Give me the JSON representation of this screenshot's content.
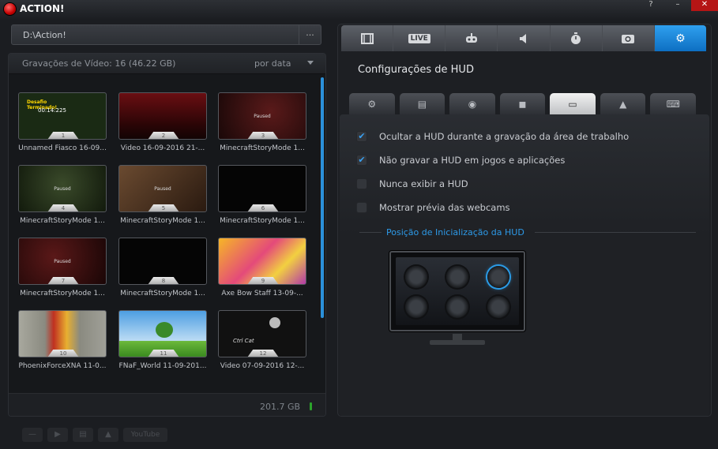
{
  "app": {
    "title": "ACTION!",
    "minimize_glyph": "–",
    "close_glyph": "✕",
    "help_glyph": "?"
  },
  "path": {
    "value": "D:\\Action!",
    "more": "..."
  },
  "library": {
    "recordings_label": "Gravações de Vídeo: 16 (46.22 GB)",
    "sort_label": "por data",
    "free_space": "201.7 GB",
    "videos": [
      {
        "number": "1",
        "name": "Unnamed Fiasco 16-09...",
        "thumb": "#1a2a14",
        "overlay_title": "Desafio Terminado!",
        "overlay_time": "00:14:225"
      },
      {
        "number": "2",
        "name": "Video 16-09-2016 21-...",
        "thumb": "#4a0a0c"
      },
      {
        "number": "3",
        "name": "MinecraftStoryMode 1...",
        "thumb": "#3a1214",
        "paused": "Paused"
      },
      {
        "number": "4",
        "name": "MinecraftStoryMode 1...",
        "thumb": "#1f2a18",
        "paused": "Paused"
      },
      {
        "number": "5",
        "name": "MinecraftStoryMode 1...",
        "thumb": "#4a3020",
        "paused": "Paused"
      },
      {
        "number": "6",
        "name": "MinecraftStoryMode 1...",
        "thumb": "#050505"
      },
      {
        "number": "7",
        "name": "MinecraftStoryMode 1...",
        "thumb": "#3a1014",
        "paused": "Paused"
      },
      {
        "number": "8",
        "name": "MinecraftStoryMode 1...",
        "thumb": "#050505"
      },
      {
        "number": "9",
        "name": "Axe Bow Staff 13-09-...",
        "thumb": "#f0a01c"
      },
      {
        "number": "10",
        "name": "PhoenixForceXNA 11-0...",
        "thumb": "#9a9a90"
      },
      {
        "number": "11",
        "name": "FNaF_World 11-09-201...",
        "thumb": "#5fa6e0"
      },
      {
        "number": "12",
        "name": "Video 07-09-2016 12-...",
        "thumb": "#111111",
        "overlay_text": "Ctrl Cat"
      }
    ]
  },
  "bottom_toolbar": {
    "youtube": "YouTube"
  },
  "main_tabs": [
    {
      "icon": "film-icon"
    },
    {
      "label": "LIVE"
    },
    {
      "icon": "gamepad-icon"
    },
    {
      "icon": "speaker-icon"
    },
    {
      "icon": "stopwatch-icon"
    },
    {
      "icon": "camera-icon"
    },
    {
      "icon": "gear-icon",
      "active": true
    }
  ],
  "settings": {
    "title": "Configurações de HUD",
    "options": [
      {
        "label": "Ocultar a HUD durante a gravação da área de trabalho",
        "checked": true
      },
      {
        "label": "Não gravar a HUD em jogos e aplicações",
        "checked": true
      },
      {
        "label": "Nunca exibir a HUD",
        "checked": false
      },
      {
        "label": "Mostrar prévia das webcams",
        "checked": false
      }
    ],
    "hud_position_title": "Posição de Inicialização da HUD",
    "hud_position_selected": "top-right"
  },
  "colors": {
    "accent": "#2b9be6",
    "close": "#b51515",
    "space_ok": "#2ba32b"
  }
}
